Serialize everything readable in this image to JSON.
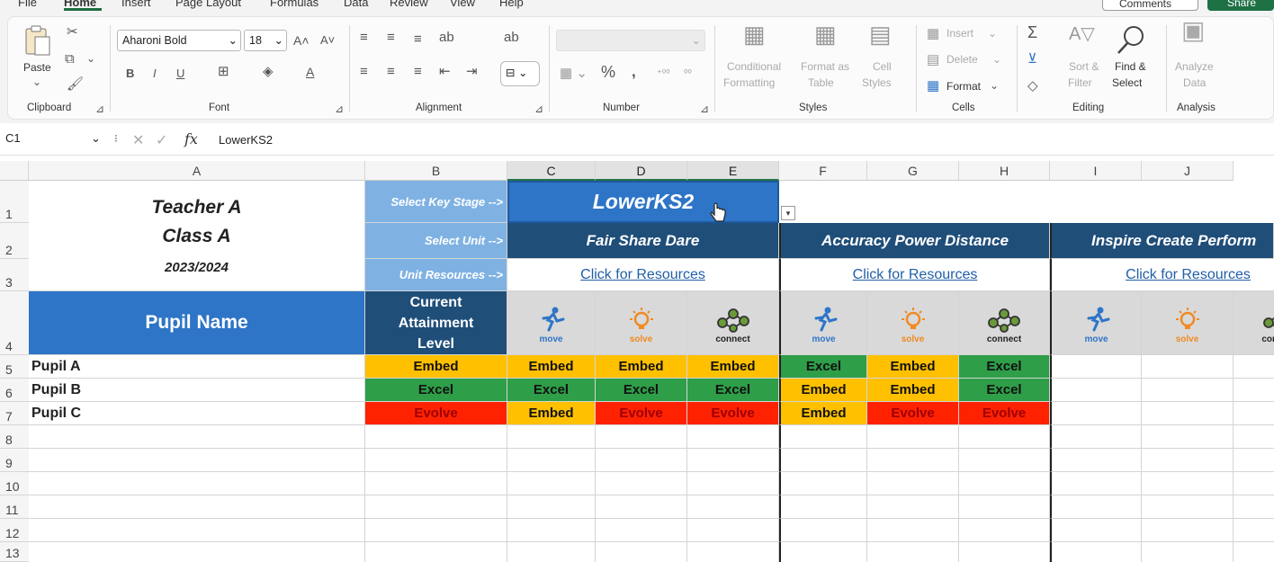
{
  "menu": {
    "tabs": [
      "File",
      "Home",
      "Insert",
      "Page Layout",
      "Formulas",
      "Data",
      "Review",
      "View",
      "Help"
    ],
    "comments": "Comments",
    "share": "Share"
  },
  "ribbon": {
    "clipboard": {
      "paste": "Paste",
      "label": "Clipboard"
    },
    "font": {
      "name": "Aharoni Bold",
      "size": "18",
      "label": "Font"
    },
    "alignment": {
      "label": "Alignment"
    },
    "number": {
      "label": "Number"
    },
    "styles": {
      "conditional": "Conditional",
      "formatting": "Formatting",
      "format_as": "Format as",
      "table": "Table",
      "cell": "Cell",
      "styles_word": "Styles",
      "label": "Styles"
    },
    "cells": {
      "insert": "Insert",
      "delete": "Delete",
      "format": "Format",
      "label": "Cells"
    },
    "editing": {
      "sort": "Sort &",
      "filter": "Filter",
      "find": "Find &",
      "select": "Select",
      "label": "Editing"
    },
    "analysis": {
      "analyze": "Analyze",
      "data": "Data",
      "label": "Analysis"
    }
  },
  "formula_bar": {
    "name_box": "C1",
    "fx": "fx",
    "value": "LowerKS2"
  },
  "columns": [
    "A",
    "B",
    "C",
    "D",
    "E",
    "F",
    "G",
    "H",
    "I",
    "J"
  ],
  "rows": [
    "1",
    "2",
    "3",
    "4",
    "5",
    "6",
    "7",
    "8",
    "9",
    "10",
    "11",
    "12",
    "13"
  ],
  "sheet": {
    "teacher": "Teacher A",
    "class": "Class A",
    "year": "2023/2024",
    "select_key_stage": "Select Key Stage -->",
    "select_unit": "Select Unit -->",
    "unit_resources": "Unit Resources -->",
    "key_stage_value": "LowerKS2",
    "pupil_name": "Pupil Name",
    "current_attainment": "Current Attainment Level",
    "units": [
      "Fair Share Dare",
      "Accuracy Power Distance",
      "Inspire Create Perform"
    ],
    "resource_link": "Click for Resources",
    "icon_labels": {
      "move": "move",
      "solve": "solve",
      "connect": "connect"
    },
    "colors": {
      "embed": "#ffc000",
      "excel": "#2e9e48",
      "evolve": "#ff2200",
      "header": "#1f4e79",
      "accent": "#2e75c7"
    },
    "pupils": [
      {
        "name": "Pupil A",
        "values": [
          "Embed",
          "Embed",
          "Embed",
          "Embed",
          "Excel",
          "Embed",
          "Excel"
        ]
      },
      {
        "name": "Pupil B",
        "values": [
          "Excel",
          "Excel",
          "Excel",
          "Excel",
          "Embed",
          "Embed",
          "Excel"
        ]
      },
      {
        "name": "Pupil C",
        "values": [
          "Evolve",
          "Embed",
          "Evolve",
          "Evolve",
          "Embed",
          "Evolve",
          "Evolve"
        ]
      }
    ]
  }
}
